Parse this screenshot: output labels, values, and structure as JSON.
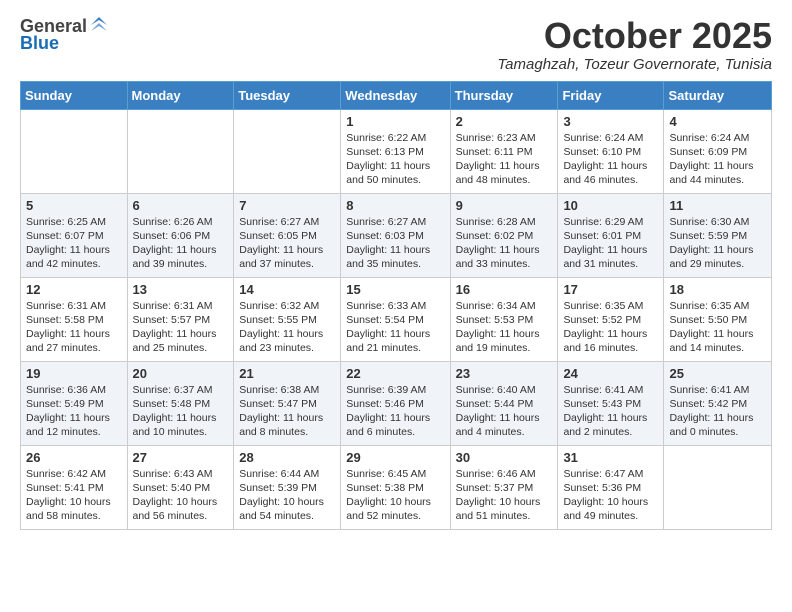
{
  "header": {
    "logo": {
      "general": "General",
      "blue": "Blue"
    },
    "title": "October 2025",
    "subtitle": "Tamaghzah, Tozeur Governorate, Tunisia"
  },
  "days_of_week": [
    "Sunday",
    "Monday",
    "Tuesday",
    "Wednesday",
    "Thursday",
    "Friday",
    "Saturday"
  ],
  "weeks": [
    [
      {
        "num": "",
        "info": ""
      },
      {
        "num": "",
        "info": ""
      },
      {
        "num": "",
        "info": ""
      },
      {
        "num": "1",
        "info": "Sunrise: 6:22 AM\nSunset: 6:13 PM\nDaylight: 11 hours\nand 50 minutes."
      },
      {
        "num": "2",
        "info": "Sunrise: 6:23 AM\nSunset: 6:11 PM\nDaylight: 11 hours\nand 48 minutes."
      },
      {
        "num": "3",
        "info": "Sunrise: 6:24 AM\nSunset: 6:10 PM\nDaylight: 11 hours\nand 46 minutes."
      },
      {
        "num": "4",
        "info": "Sunrise: 6:24 AM\nSunset: 6:09 PM\nDaylight: 11 hours\nand 44 minutes."
      }
    ],
    [
      {
        "num": "5",
        "info": "Sunrise: 6:25 AM\nSunset: 6:07 PM\nDaylight: 11 hours\nand 42 minutes."
      },
      {
        "num": "6",
        "info": "Sunrise: 6:26 AM\nSunset: 6:06 PM\nDaylight: 11 hours\nand 39 minutes."
      },
      {
        "num": "7",
        "info": "Sunrise: 6:27 AM\nSunset: 6:05 PM\nDaylight: 11 hours\nand 37 minutes."
      },
      {
        "num": "8",
        "info": "Sunrise: 6:27 AM\nSunset: 6:03 PM\nDaylight: 11 hours\nand 35 minutes."
      },
      {
        "num": "9",
        "info": "Sunrise: 6:28 AM\nSunset: 6:02 PM\nDaylight: 11 hours\nand 33 minutes."
      },
      {
        "num": "10",
        "info": "Sunrise: 6:29 AM\nSunset: 6:01 PM\nDaylight: 11 hours\nand 31 minutes."
      },
      {
        "num": "11",
        "info": "Sunrise: 6:30 AM\nSunset: 5:59 PM\nDaylight: 11 hours\nand 29 minutes."
      }
    ],
    [
      {
        "num": "12",
        "info": "Sunrise: 6:31 AM\nSunset: 5:58 PM\nDaylight: 11 hours\nand 27 minutes."
      },
      {
        "num": "13",
        "info": "Sunrise: 6:31 AM\nSunset: 5:57 PM\nDaylight: 11 hours\nand 25 minutes."
      },
      {
        "num": "14",
        "info": "Sunrise: 6:32 AM\nSunset: 5:55 PM\nDaylight: 11 hours\nand 23 minutes."
      },
      {
        "num": "15",
        "info": "Sunrise: 6:33 AM\nSunset: 5:54 PM\nDaylight: 11 hours\nand 21 minutes."
      },
      {
        "num": "16",
        "info": "Sunrise: 6:34 AM\nSunset: 5:53 PM\nDaylight: 11 hours\nand 19 minutes."
      },
      {
        "num": "17",
        "info": "Sunrise: 6:35 AM\nSunset: 5:52 PM\nDaylight: 11 hours\nand 16 minutes."
      },
      {
        "num": "18",
        "info": "Sunrise: 6:35 AM\nSunset: 5:50 PM\nDaylight: 11 hours\nand 14 minutes."
      }
    ],
    [
      {
        "num": "19",
        "info": "Sunrise: 6:36 AM\nSunset: 5:49 PM\nDaylight: 11 hours\nand 12 minutes."
      },
      {
        "num": "20",
        "info": "Sunrise: 6:37 AM\nSunset: 5:48 PM\nDaylight: 11 hours\nand 10 minutes."
      },
      {
        "num": "21",
        "info": "Sunrise: 6:38 AM\nSunset: 5:47 PM\nDaylight: 11 hours\nand 8 minutes."
      },
      {
        "num": "22",
        "info": "Sunrise: 6:39 AM\nSunset: 5:46 PM\nDaylight: 11 hours\nand 6 minutes."
      },
      {
        "num": "23",
        "info": "Sunrise: 6:40 AM\nSunset: 5:44 PM\nDaylight: 11 hours\nand 4 minutes."
      },
      {
        "num": "24",
        "info": "Sunrise: 6:41 AM\nSunset: 5:43 PM\nDaylight: 11 hours\nand 2 minutes."
      },
      {
        "num": "25",
        "info": "Sunrise: 6:41 AM\nSunset: 5:42 PM\nDaylight: 11 hours\nand 0 minutes."
      }
    ],
    [
      {
        "num": "26",
        "info": "Sunrise: 6:42 AM\nSunset: 5:41 PM\nDaylight: 10 hours\nand 58 minutes."
      },
      {
        "num": "27",
        "info": "Sunrise: 6:43 AM\nSunset: 5:40 PM\nDaylight: 10 hours\nand 56 minutes."
      },
      {
        "num": "28",
        "info": "Sunrise: 6:44 AM\nSunset: 5:39 PM\nDaylight: 10 hours\nand 54 minutes."
      },
      {
        "num": "29",
        "info": "Sunrise: 6:45 AM\nSunset: 5:38 PM\nDaylight: 10 hours\nand 52 minutes."
      },
      {
        "num": "30",
        "info": "Sunrise: 6:46 AM\nSunset: 5:37 PM\nDaylight: 10 hours\nand 51 minutes."
      },
      {
        "num": "31",
        "info": "Sunrise: 6:47 AM\nSunset: 5:36 PM\nDaylight: 10 hours\nand 49 minutes."
      },
      {
        "num": "",
        "info": ""
      }
    ]
  ]
}
